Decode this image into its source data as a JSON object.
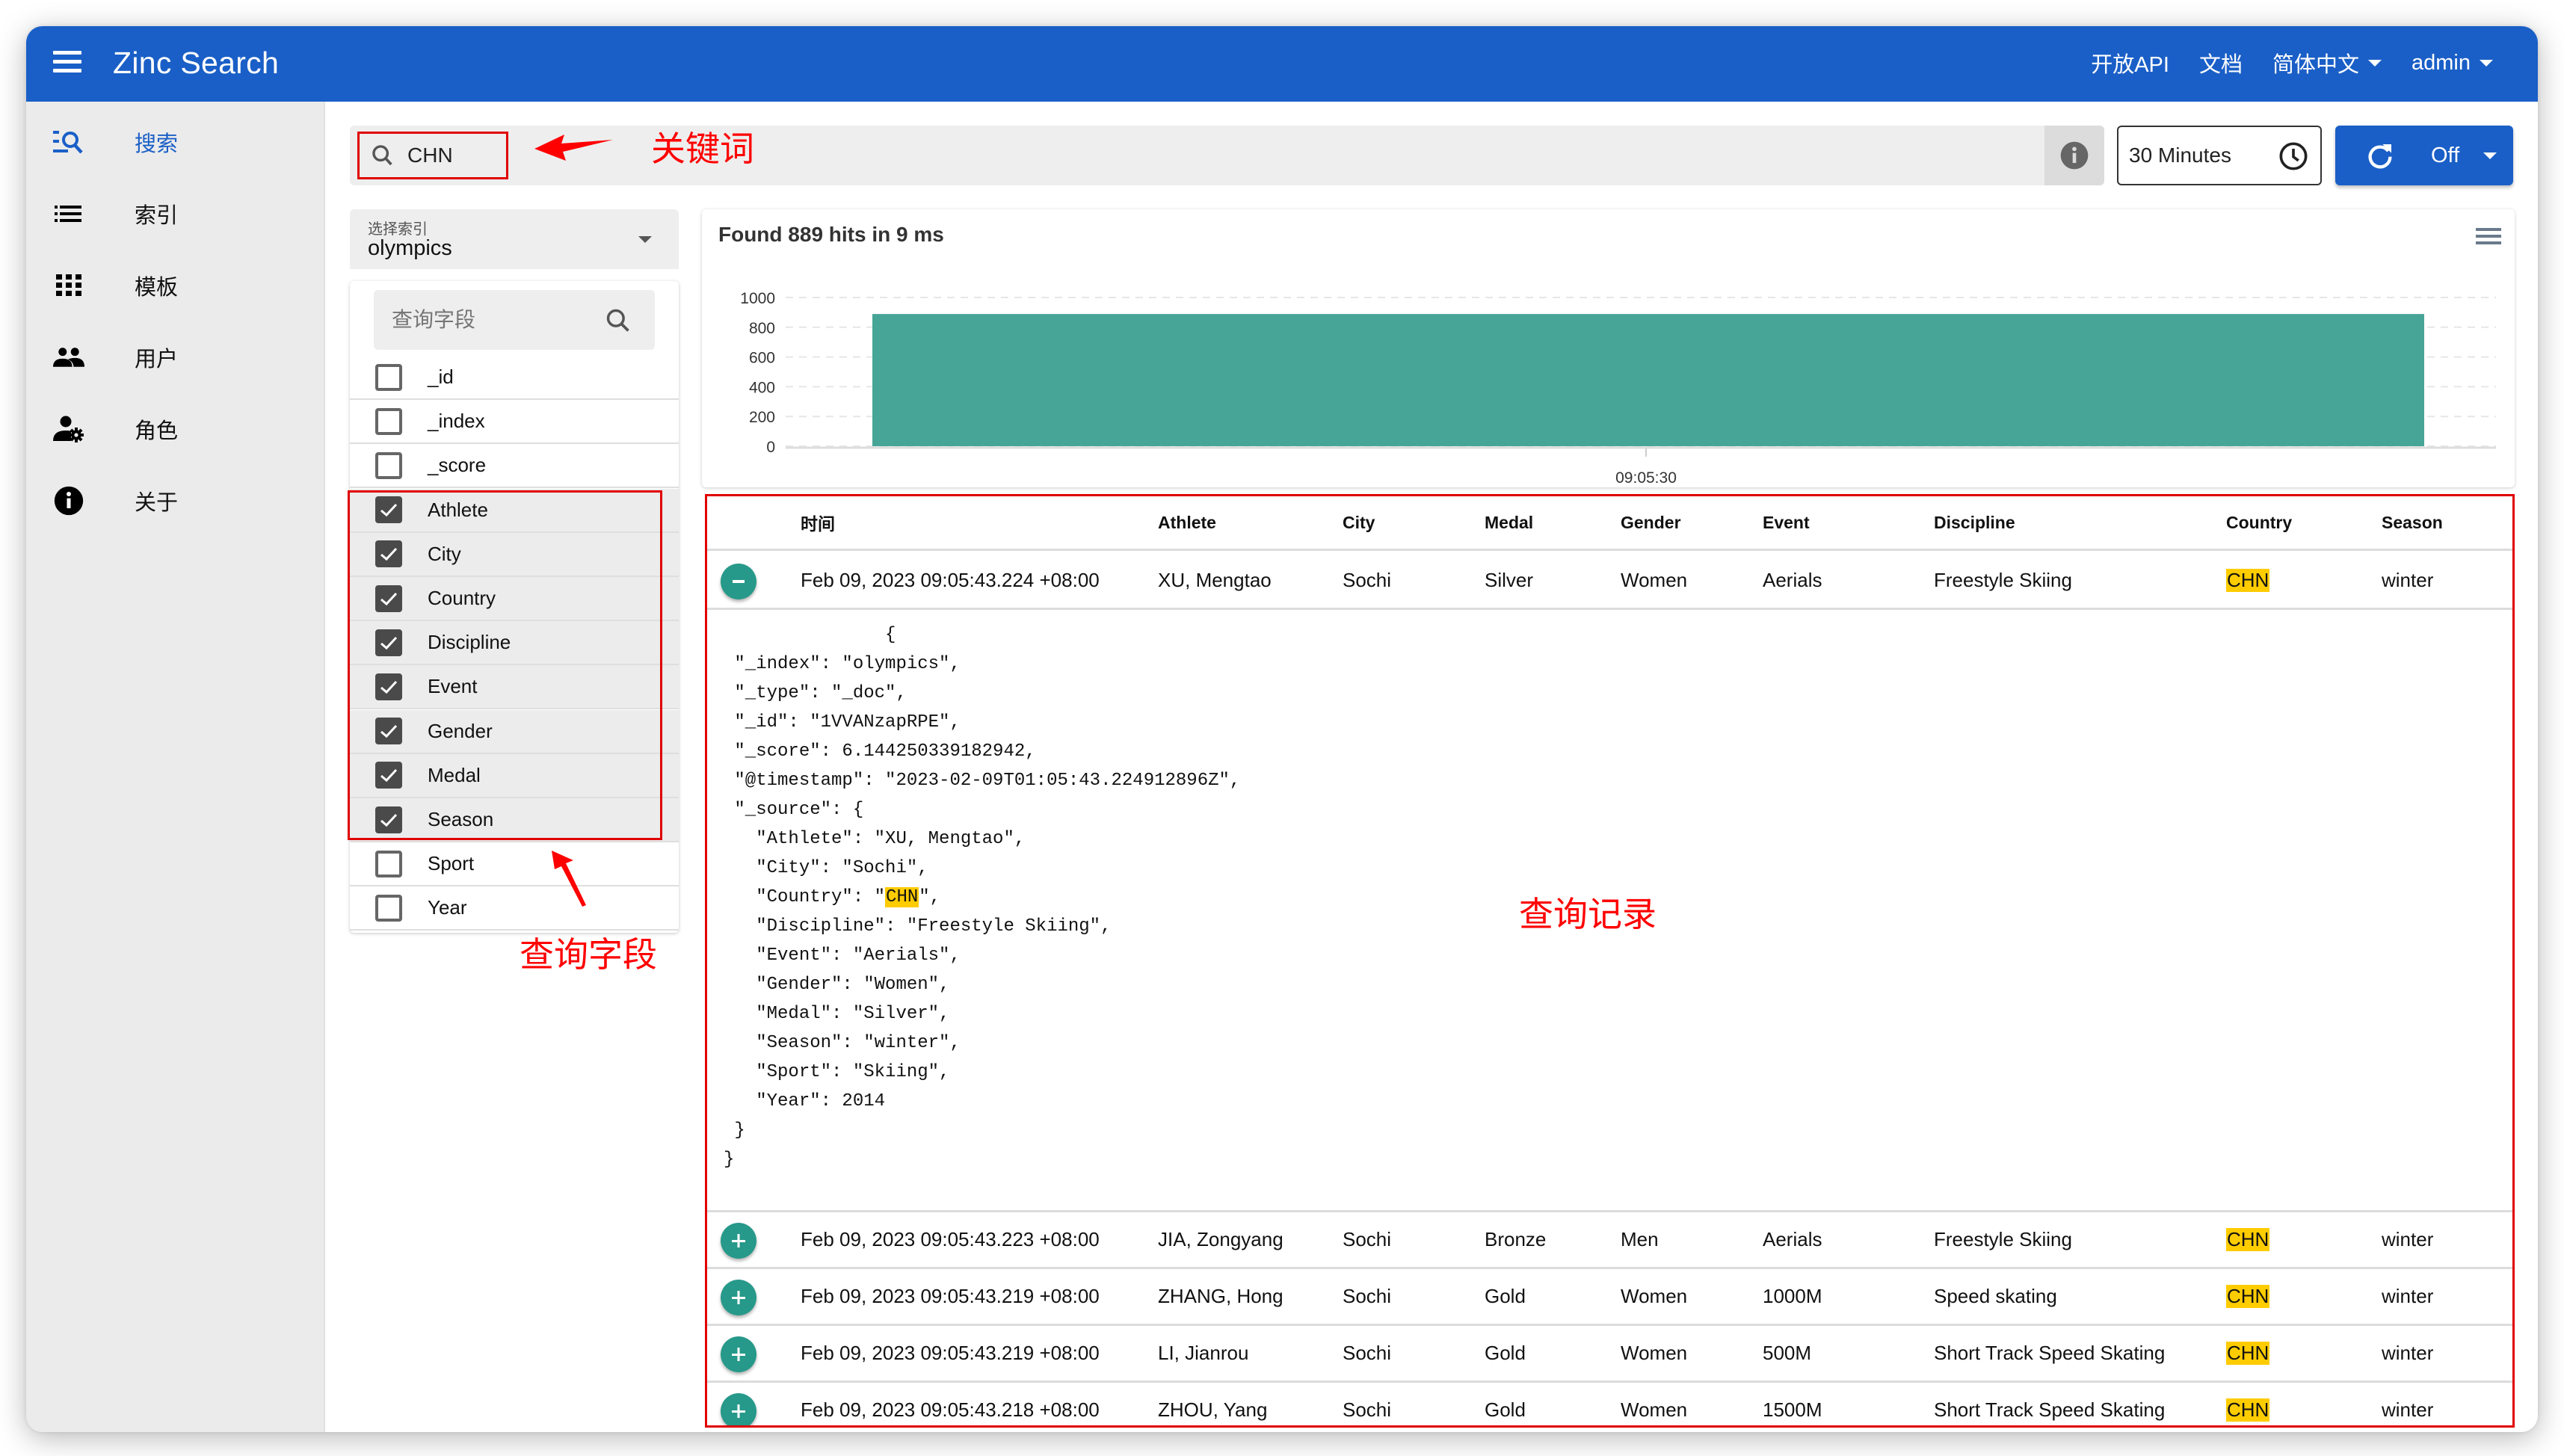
{
  "header": {
    "title": "Zinc Search",
    "links": [
      {
        "label": "开放API",
        "dropdown": false
      },
      {
        "label": "文档",
        "dropdown": false
      },
      {
        "label": "简体中文",
        "dropdown": true
      },
      {
        "label": "admin",
        "dropdown": true
      }
    ]
  },
  "sidebar": {
    "items": [
      {
        "label": "搜索",
        "icon": "search-list-icon",
        "active": true
      },
      {
        "label": "索引",
        "icon": "list-icon",
        "active": false
      },
      {
        "label": "模板",
        "icon": "grid-icon",
        "active": false
      },
      {
        "label": "用户",
        "icon": "people-icon",
        "active": false
      },
      {
        "label": "角色",
        "icon": "user-settings-icon",
        "active": false
      },
      {
        "label": "关于",
        "icon": "info-icon",
        "active": false
      }
    ]
  },
  "search": {
    "query": "CHN",
    "time_range": "30 Minutes",
    "refresh_label": "Off"
  },
  "index_select": {
    "label": "选择索引",
    "value": "olympics"
  },
  "fields": {
    "search_placeholder": "查询字段",
    "items": [
      {
        "name": "_id",
        "checked": false
      },
      {
        "name": "_index",
        "checked": false
      },
      {
        "name": "_score",
        "checked": false
      },
      {
        "name": "Athlete",
        "checked": true
      },
      {
        "name": "City",
        "checked": true
      },
      {
        "name": "Country",
        "checked": true
      },
      {
        "name": "Discipline",
        "checked": true
      },
      {
        "name": "Event",
        "checked": true
      },
      {
        "name": "Gender",
        "checked": true
      },
      {
        "name": "Medal",
        "checked": true
      },
      {
        "name": "Season",
        "checked": true
      },
      {
        "name": "Sport",
        "checked": false
      },
      {
        "name": "Year",
        "checked": false
      }
    ]
  },
  "results": {
    "summary": "Found 889 hits in 9 ms",
    "columns": [
      "时间",
      "Athlete",
      "City",
      "Medal",
      "Gender",
      "Event",
      "Discipline",
      "Country",
      "Season"
    ],
    "highlight_term": "CHN",
    "highlight_color": "#ffcc00",
    "rows": [
      {
        "expanded": true,
        "cells": [
          "Feb 09, 2023 09:05:43.224 +08:00",
          "XU, Mengtao",
          "Sochi",
          "Silver",
          "Women",
          "Aerials",
          "Freestyle Skiing",
          "CHN",
          "winter"
        ]
      },
      {
        "expanded": false,
        "cells": [
          "Feb 09, 2023 09:05:43.223 +08:00",
          "JIA, Zongyang",
          "Sochi",
          "Bronze",
          "Men",
          "Aerials",
          "Freestyle Skiing",
          "CHN",
          "winter"
        ]
      },
      {
        "expanded": false,
        "cells": [
          "Feb 09, 2023 09:05:43.219 +08:00",
          "ZHANG, Hong",
          "Sochi",
          "Gold",
          "Women",
          "1000M",
          "Speed skating",
          "CHN",
          "winter"
        ]
      },
      {
        "expanded": false,
        "cells": [
          "Feb 09, 2023 09:05:43.219 +08:00",
          "LI, Jianrou",
          "Sochi",
          "Gold",
          "Women",
          "500M",
          "Short Track Speed Skating",
          "CHN",
          "winter"
        ]
      },
      {
        "expanded": false,
        "cells": [
          "Feb 09, 2023 09:05:43.218 +08:00",
          "ZHOU, Yang",
          "Sochi",
          "Gold",
          "Women",
          "1500M",
          "Short Track Speed Skating",
          "CHN",
          "winter"
        ]
      }
    ],
    "detail_json_lines": [
      "               {",
      " \"_index\": \"olympics\",",
      " \"_type\": \"_doc\",",
      " \"_id\": \"1VVANzapRPE\",",
      " \"_score\": 6.144250339182942,",
      " \"@timestamp\": \"2023-02-09T01:05:43.224912896Z\",",
      " \"_source\": {",
      "   \"Athlete\": \"XU, Mengtao\",",
      "   \"City\": \"Sochi\",",
      "   \"Country\": \"CHN\",",
      "   \"Discipline\": \"Freestyle Skiing\",",
      "   \"Event\": \"Aerials\",",
      "   \"Gender\": \"Women\",",
      "   \"Medal\": \"Silver\",",
      "   \"Season\": \"winter\",",
      "   \"Sport\": \"Skiing\",",
      "   \"Year\": 2014",
      " }",
      "}"
    ]
  },
  "chart_data": {
    "type": "bar",
    "title": "",
    "categories": [
      "09:05:30"
    ],
    "values": [
      889
    ],
    "xlabel": "",
    "ylabel": "",
    "ylim": [
      0,
      1000
    ],
    "yticks": [
      0,
      200,
      400,
      600,
      800,
      1000
    ],
    "grid": true,
    "bar_color": "#47a597"
  },
  "annotations": {
    "keyword": "关键词",
    "fields": "查询字段",
    "records": "查询记录"
  },
  "colors": {
    "primary": "#1a5fc7",
    "accent_teal": "#26998a",
    "annotation_red": "#ff0000"
  }
}
